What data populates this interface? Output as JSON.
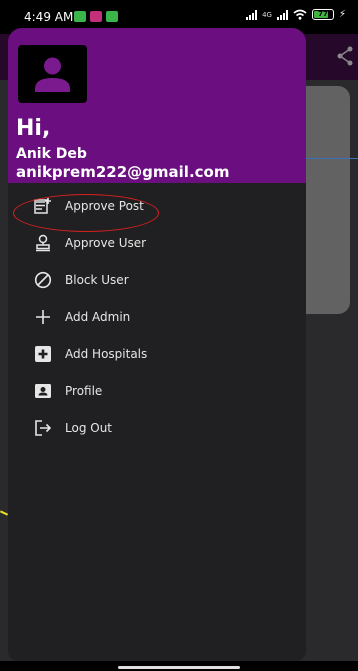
{
  "status_bar": {
    "time": "4:49 AM",
    "network_label_1": "4G",
    "battery_level": 0.77,
    "battery_text": "77"
  },
  "drawer": {
    "header": {
      "greeting": "Hi,",
      "name": "Anik Deb",
      "email": "anikprem222@gmail.com"
    },
    "items": [
      {
        "label": "Approve Post",
        "icon": "approve-post-icon"
      },
      {
        "label": "Approve User",
        "icon": "approve-user-icon"
      },
      {
        "label": "Block User",
        "icon": "block-icon"
      },
      {
        "label": "Add Admin",
        "icon": "plus-icon"
      },
      {
        "label": "Add Hospitals",
        "icon": "medical-plus-icon"
      },
      {
        "label": "Profile",
        "icon": "profile-card-icon"
      },
      {
        "label": "Log Out",
        "icon": "logout-icon"
      }
    ]
  },
  "colors": {
    "header": "#6a0e80",
    "drawer_bg": "#202022",
    "highlight": "#d92020"
  }
}
